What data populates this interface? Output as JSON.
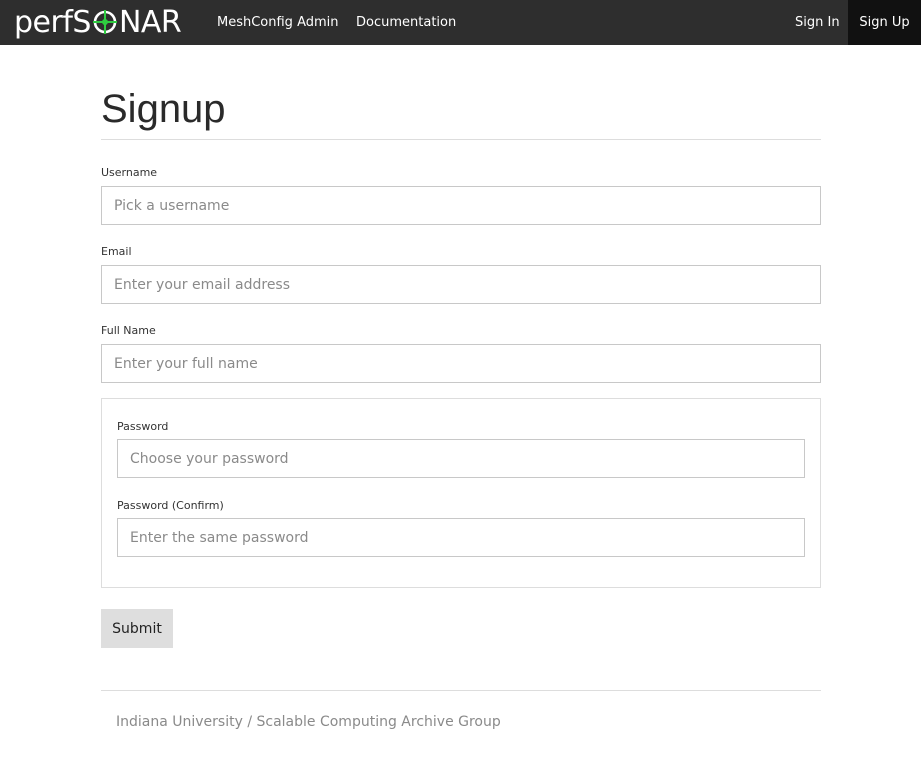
{
  "brand": {
    "prefix": "perfS",
    "suffix": "NAR",
    "logo_accent": "#2ecc40"
  },
  "nav": {
    "links": [
      {
        "label": "MeshConfig Admin"
      },
      {
        "label": "Documentation"
      }
    ],
    "sign_in": "Sign In",
    "sign_up": "Sign Up"
  },
  "page": {
    "title": "Signup"
  },
  "form": {
    "username": {
      "label": "Username",
      "placeholder": "Pick a username",
      "value": ""
    },
    "email": {
      "label": "Email",
      "placeholder": "Enter your email address",
      "value": ""
    },
    "fullname": {
      "label": "Full Name",
      "placeholder": "Enter your full name",
      "value": ""
    },
    "password": {
      "label": "Password",
      "placeholder": "Choose your password",
      "value": ""
    },
    "password_confirm": {
      "label": "Password (Confirm)",
      "placeholder": "Enter the same password",
      "value": ""
    },
    "submit_label": "Submit"
  },
  "footer": {
    "text": "Indiana University / Scalable Computing Archive Group"
  },
  "colors": {
    "navbar": "#2e2e2e",
    "active_nav": "#111111",
    "submit_bg": "#dedede"
  }
}
